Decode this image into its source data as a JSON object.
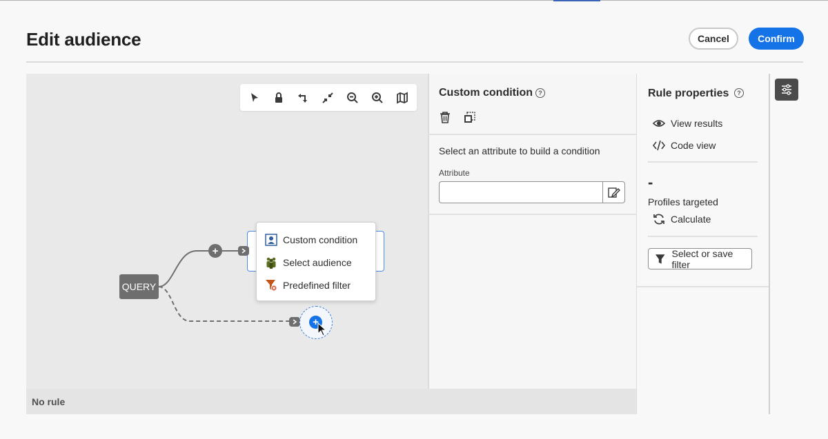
{
  "header": {
    "title": "Edit audience",
    "cancel_label": "Cancel",
    "confirm_label": "Confirm"
  },
  "canvas": {
    "query_label": "QUERY",
    "toolbar_icons": [
      "pointer-icon",
      "lock-icon",
      "rotate-icon",
      "collapse-icon",
      "zoom-out-icon",
      "zoom-in-icon",
      "map-icon"
    ],
    "menu": {
      "items": [
        {
          "label": "Custom condition",
          "icon": "custom-condition-icon"
        },
        {
          "label": "Select audience",
          "icon": "audience-icon"
        },
        {
          "label": "Predefined filter",
          "icon": "predefined-filter-icon"
        }
      ]
    }
  },
  "status_bar": {
    "text": "No rule"
  },
  "custom_condition": {
    "title": "Custom condition",
    "instruction": "Select an attribute to build a condition",
    "attribute_label": "Attribute",
    "attribute_value": ""
  },
  "rule_properties": {
    "title": "Rule properties",
    "view_results": "View results",
    "code_view": "Code view",
    "profiles_value": "-",
    "profiles_label": "Profiles targeted",
    "calculate": "Calculate",
    "filter_button": "Select or save filter"
  },
  "colors": {
    "accent": "#1473e6",
    "node": "#6e6e6e",
    "canvas": "#e9e9e9"
  }
}
